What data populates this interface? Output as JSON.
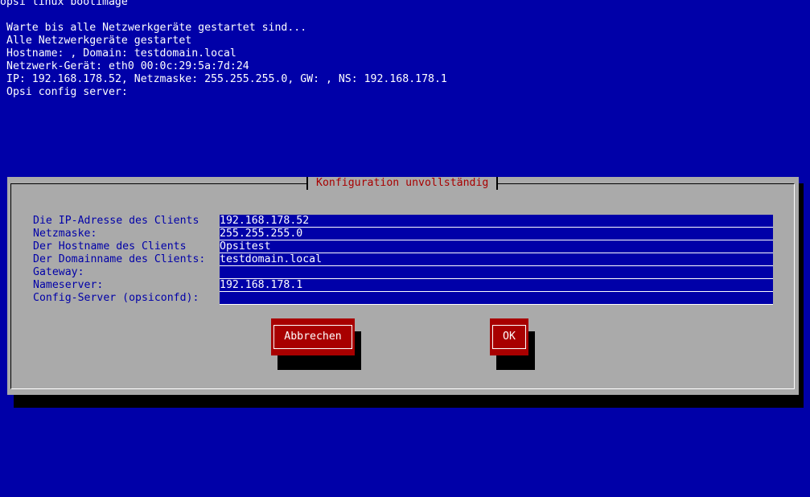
{
  "terminal": {
    "title": "opsi linux bootimage",
    "lines": [
      "Warte bis alle Netzwerkgeräte gestartet sind...",
      "Alle Netzwerkgeräte gestartet",
      "Hostname: , Domain: testdomain.local",
      "Netzwerk-Gerät: eth0 00:0c:29:5a:7d:24",
      "IP: 192.168.178.52, Netzmaske: 255.255.255.0, GW: , NS: 192.168.178.1",
      "Opsi config server:"
    ]
  },
  "dialog": {
    "title": "Konfiguration unvollständig",
    "fields": [
      {
        "label": "Die IP-Adresse des Clients",
        "value": "192.168.178.52"
      },
      {
        "label": "Netzmaske:",
        "value": "255.255.255.0"
      },
      {
        "label": "Der Hostname des Clients",
        "value": "Opsitest"
      },
      {
        "label": "Der Domainname des Clients:",
        "value": "testdomain.local"
      },
      {
        "label": "Gateway:",
        "value": ""
      },
      {
        "label": "Nameserver:",
        "value": "192.168.178.1"
      },
      {
        "label": "Config-Server (opsiconfd):",
        "value": ""
      }
    ],
    "buttons": {
      "cancel": "Abbrechen",
      "ok": "OK"
    }
  },
  "colors": {
    "background": "#0000a8",
    "dialog": "#aaaaaa",
    "title_text": "#a80000",
    "button": "#a80000"
  }
}
